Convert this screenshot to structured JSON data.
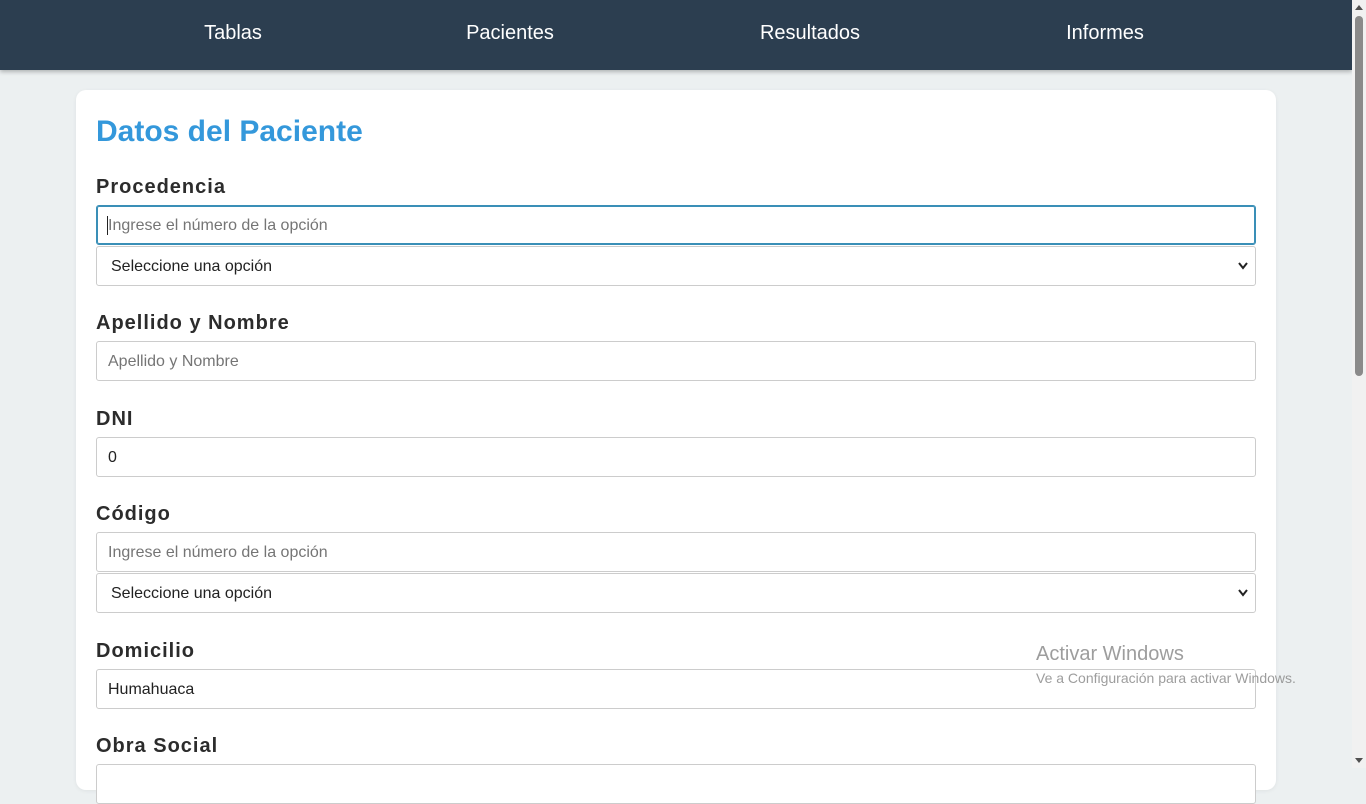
{
  "nav": {
    "items": [
      {
        "label": "Tablas"
      },
      {
        "label": "Pacientes"
      },
      {
        "label": "Resultados"
      },
      {
        "label": "Informes"
      }
    ]
  },
  "form": {
    "title": "Datos del Paciente",
    "procedencia": {
      "label": "Procedencia",
      "input_placeholder": "Ingrese el número de la opción",
      "input_value": "",
      "select_value": "Seleccione una opción"
    },
    "apellido_nombre": {
      "label": "Apellido y Nombre",
      "placeholder": "Apellido y Nombre",
      "value": ""
    },
    "dni": {
      "label": "DNI",
      "value": "0"
    },
    "codigo": {
      "label": "Código",
      "input_placeholder": "Ingrese el número de la opción",
      "input_value": "",
      "select_value": "Seleccione una opción"
    },
    "domicilio": {
      "label": "Domicilio",
      "value": "Humahuaca"
    },
    "obra_social": {
      "label": "Obra Social"
    }
  },
  "watermark": {
    "title": "Activar Windows",
    "subtitle": "Ve a Configuración para activar Windows."
  }
}
